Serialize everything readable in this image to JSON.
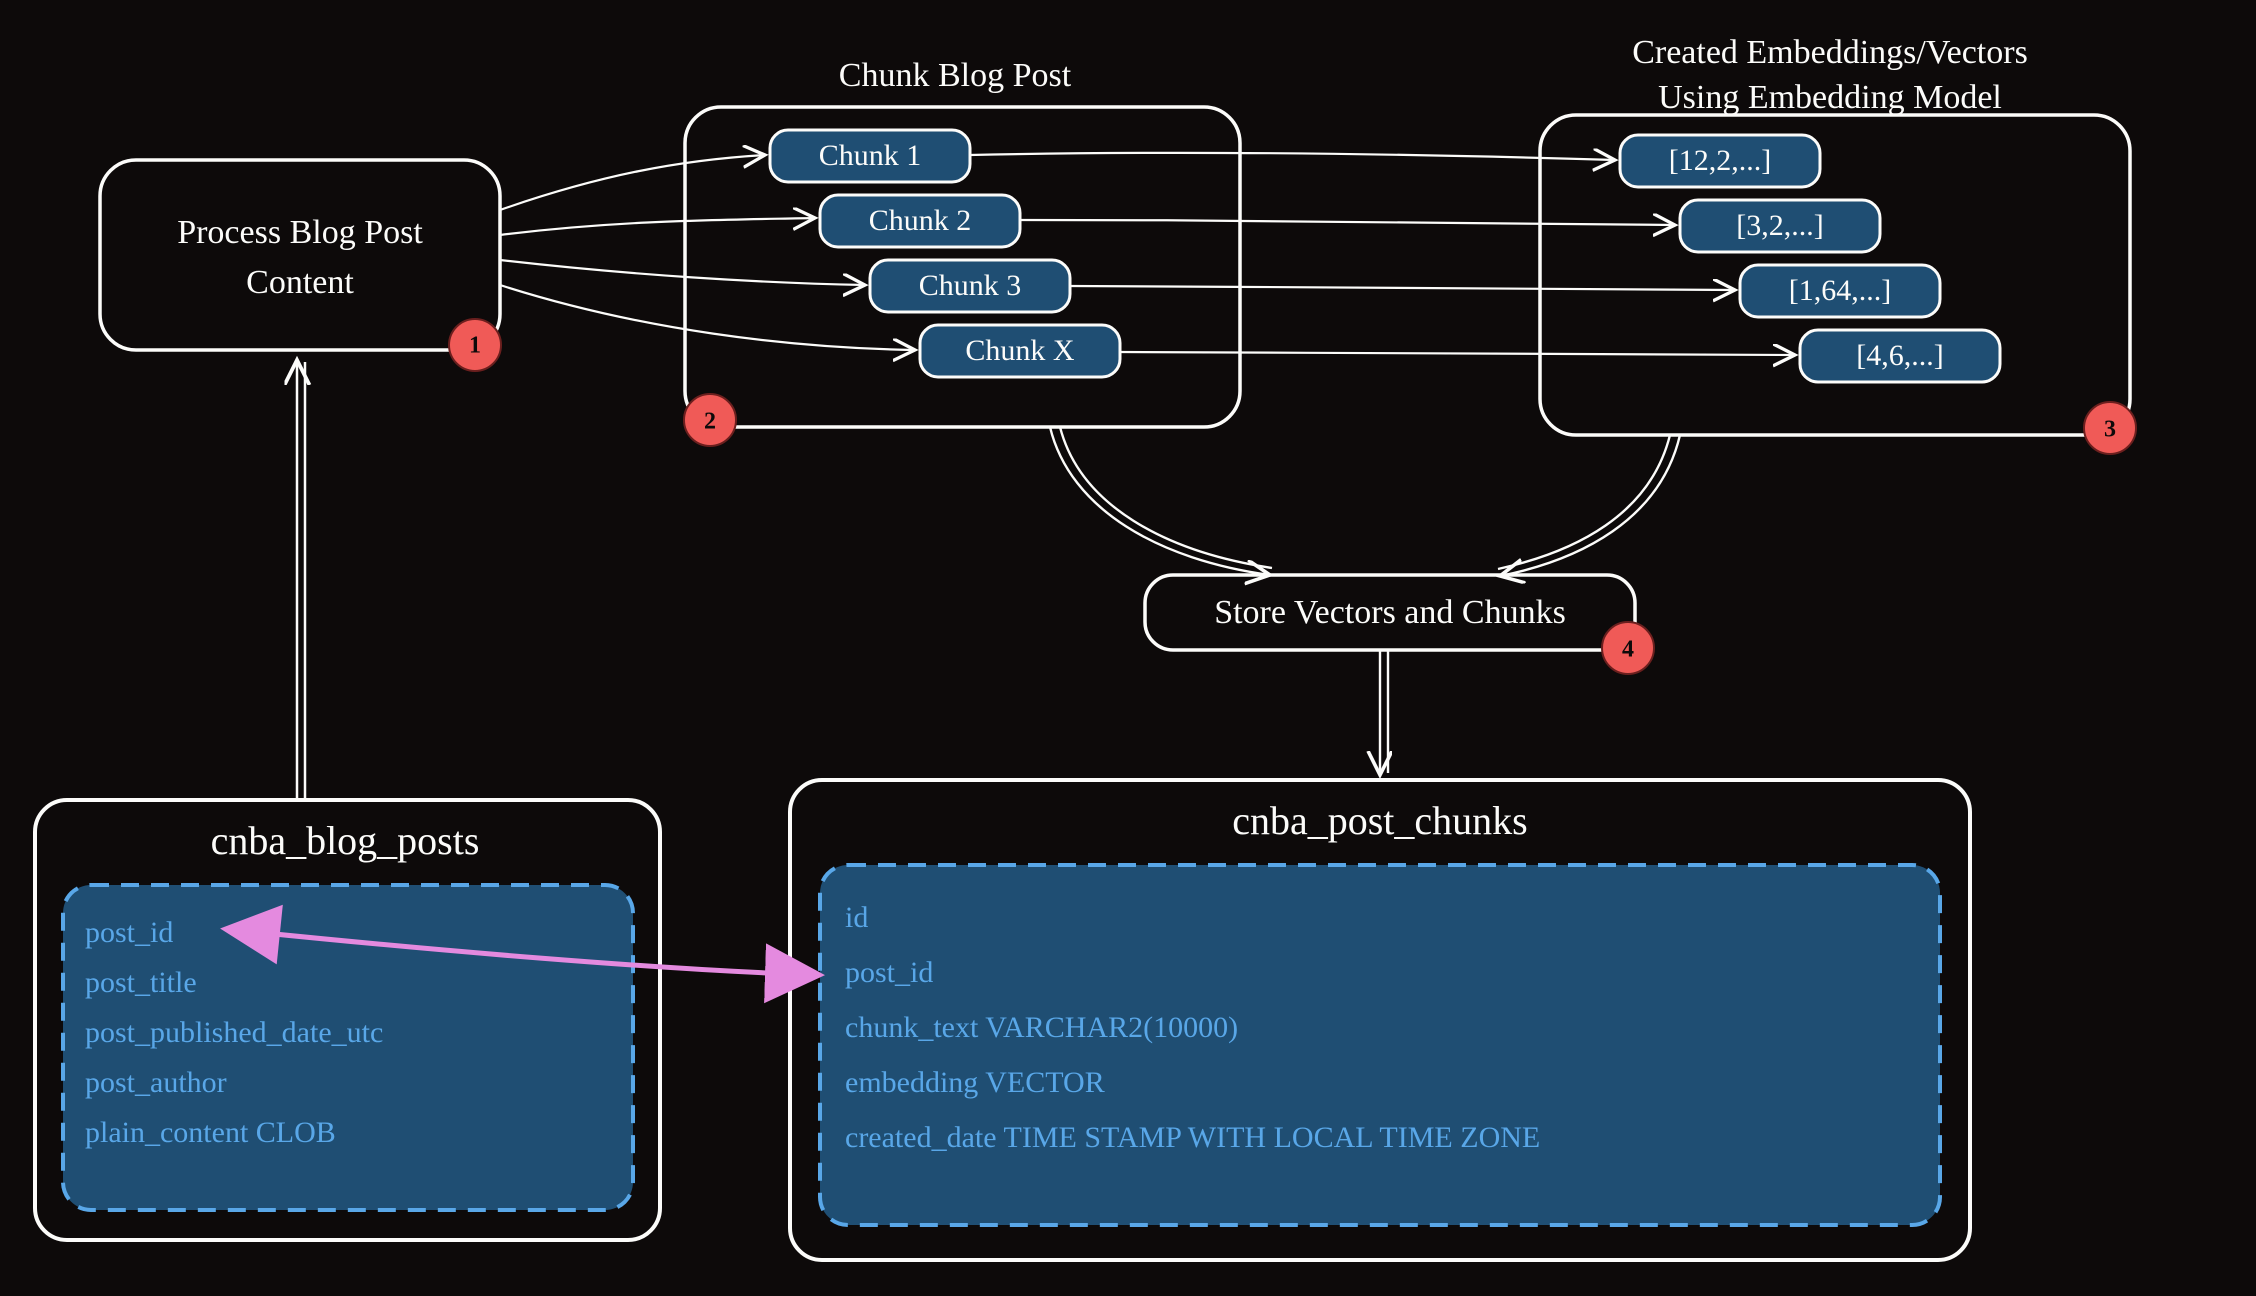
{
  "step1": {
    "title_line1": "Process Blog Post",
    "title_line2": "Content",
    "badge": "1"
  },
  "step2": {
    "title": "Chunk Blog Post",
    "badge": "2",
    "chunks": [
      "Chunk 1",
      "Chunk 2",
      "Chunk 3",
      "Chunk X"
    ]
  },
  "step3": {
    "title_line1": "Created Embeddings/Vectors",
    "title_line2": "Using Embedding Model",
    "badge": "3",
    "vectors": [
      "[12,2,...]",
      "[3,2,...]",
      "[1,64,...]",
      "[4,6,...]"
    ]
  },
  "step4": {
    "title": "Store Vectors and Chunks",
    "badge": "4"
  },
  "table1": {
    "name": "cnba_blog_posts",
    "columns": [
      "post_id",
      "post_title",
      "post_published_date_utc",
      "post_author",
      "plain_content CLOB"
    ]
  },
  "table2": {
    "name": "cnba_post_chunks",
    "columns": [
      "id",
      "post_id",
      "chunk_text VARCHAR2(10000)",
      "embedding VECTOR",
      "created_date TIME STAMP WITH LOCAL TIME ZONE"
    ]
  }
}
